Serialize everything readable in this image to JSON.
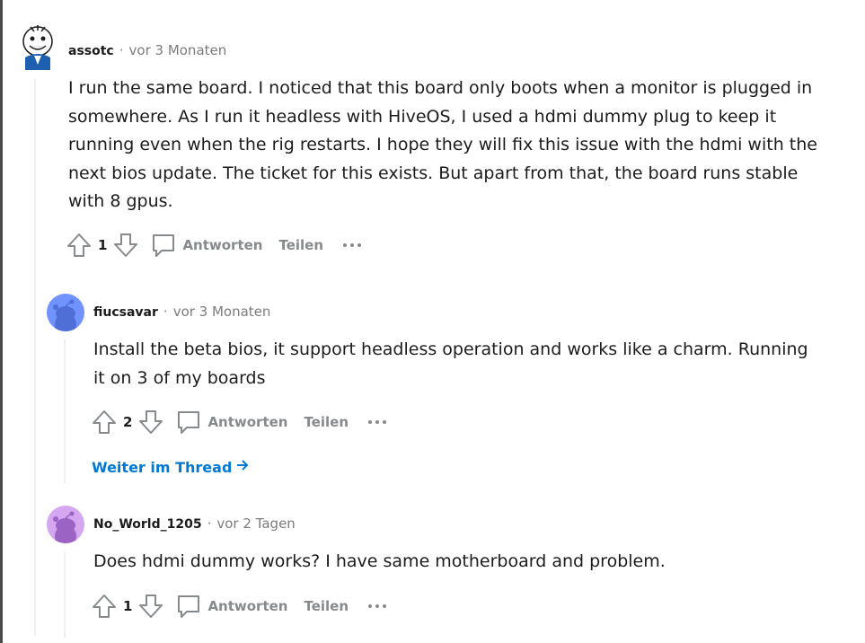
{
  "comments": [
    {
      "username": "assotc",
      "time": "vor 3 Monaten",
      "text": "I run the same board. I noticed that this board only boots when a monitor is plugged in somewhere. As I run it headless with HiveOS, I used a hdmi dummy plug to keep it running even when the rig restarts. I hope they will fix this issue with the hdmi with the next bios update. The ticket for this exists. But apart from that, the board runs stable with 8 gpus.",
      "score": "1"
    },
    {
      "username": "fiucsavar",
      "time": "vor 3 Monaten",
      "text": "Install the beta bios, it support headless operation and works like a charm. Running it on 3 of my boards",
      "score": "2"
    },
    {
      "username": "No_World_1205",
      "time": "vor 2 Tagen",
      "text": "Does hdmi dummy works? I have same motherboard and problem.",
      "score": "1"
    }
  ],
  "labels": {
    "reply": "Antworten",
    "share": "Teilen",
    "continue_thread": "Weiter im Thread",
    "separator": "·"
  },
  "colors": {
    "link": "#0079d3",
    "muted": "#878a8c",
    "rail": "#edeff1",
    "avatar_blue": "#7193ff",
    "avatar_purple": "#d4a7f0"
  },
  "icons": [
    "upvote-icon",
    "downvote-icon",
    "comment-icon",
    "more-icon",
    "arrow-right-icon"
  ]
}
